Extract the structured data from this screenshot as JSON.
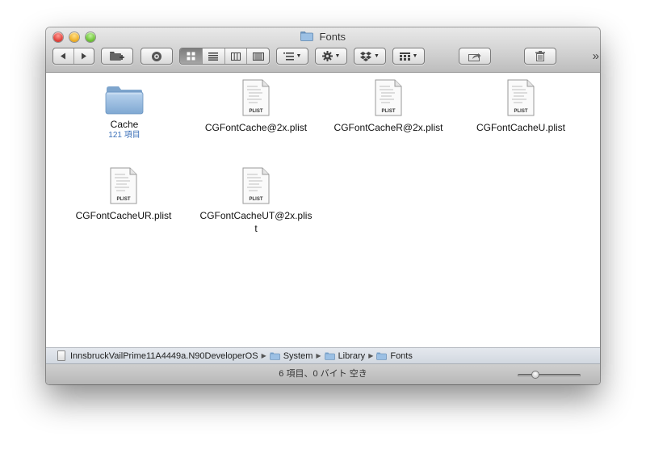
{
  "window": {
    "title": "Fonts"
  },
  "toolbar": {
    "back_icon": "chevron-left-icon",
    "forward_icon": "chevron-right-icon",
    "view_modes": [
      "icon-view",
      "list-view",
      "column-view",
      "coverflow-view"
    ],
    "active_view": "icon-view"
  },
  "items": [
    {
      "name": "Cache",
      "sub": "121 項目",
      "kind": "folder"
    },
    {
      "name": "CGFontCache@2x.plist",
      "kind": "plist"
    },
    {
      "name": "CGFontCacheR@2x.plist",
      "kind": "plist"
    },
    {
      "name": "CGFontCacheU.plist",
      "kind": "plist"
    },
    {
      "name": "CGFontCacheUR.plist",
      "kind": "plist"
    },
    {
      "name": "CGFontCacheUT@2x.plist",
      "kind": "plist"
    }
  ],
  "plist_label": "PLIST",
  "pathbar": {
    "volume": "InnsbruckVailPrime11A4449a.N90DeveloperOS",
    "crumbs": [
      "System",
      "Library",
      "Fonts"
    ]
  },
  "status": {
    "text": "6 項目、0 バイト 空き",
    "icon_size_level": 0.25
  },
  "colors": {
    "folder_blue": "#8fb3d8",
    "sub_text": "#3a6fb8"
  }
}
